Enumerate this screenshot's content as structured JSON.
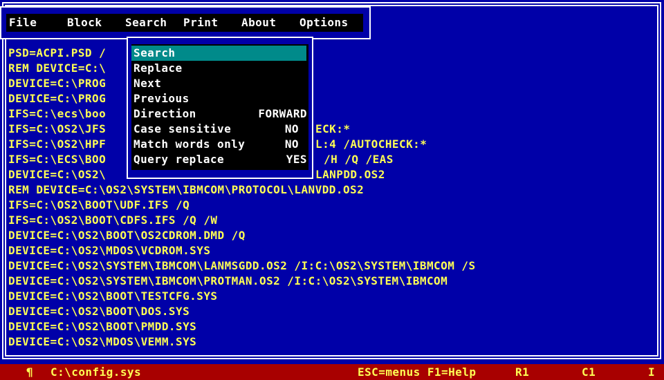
{
  "menu": {
    "items": [
      "File",
      "Block",
      "Search",
      "Print",
      "About",
      "Options"
    ]
  },
  "search_menu": {
    "items": [
      {
        "label": "Search",
        "value": ""
      },
      {
        "label": "Replace",
        "value": ""
      },
      {
        "label": "Next",
        "value": ""
      },
      {
        "label": "Previous",
        "value": ""
      },
      {
        "label": "Direction",
        "value": "FORWARD"
      },
      {
        "label": "Case sensitive",
        "value": "NO"
      },
      {
        "label": "Match words only",
        "value": "NO"
      },
      {
        "label": "Query replace",
        "value": "YES"
      }
    ],
    "selected_index": 0
  },
  "editor": {
    "lines": [
      "PSD=ACPI.PSD /",
      "REM DEVICE=C:\\",
      "DEVICE=C:\\PROG",
      "DEVICE=C:\\PROG",
      "IFS=C:\\ecs\\boo",
      "IFS=C:\\OS2\\JFS",
      "IFS=C:\\OS2\\HPF",
      "IFS=C:\\ECS\\BOO",
      "DEVICE=C:\\OS2\\",
      "REM DEVICE=C:\\OS2\\SYSTEM\\IBMCOM\\PROTOCOL\\LANVDD.OS2",
      "IFS=C:\\OS2\\BOOT\\UDF.IFS /Q",
      "IFS=C:\\OS2\\BOOT\\CDFS.IFS /Q /W",
      "DEVICE=C:\\OS2\\BOOT\\OS2CDROM.DMD /Q",
      "DEVICE=C:\\OS2\\MDOS\\VCDROM.SYS",
      "DEVICE=C:\\OS2\\SYSTEM\\IBMCOM\\LANMSGDD.OS2 /I:C:\\OS2\\SYSTEM\\IBMCOM /S",
      "DEVICE=C:\\OS2\\SYSTEM\\IBMCOM\\PROTMAN.OS2 /I:C:\\OS2\\SYSTEM\\IBMCOM",
      "DEVICE=C:\\OS2\\BOOT\\TESTCFG.SYS",
      "DEVICE=C:\\OS2\\BOOT\\DOS.SYS",
      "DEVICE=C:\\OS2\\BOOT\\PMDD.SYS",
      "DEVICE=C:\\OS2\\MDOS\\VEMM.SYS"
    ],
    "line_tails": [
      {
        "line": 5,
        "text": "ECK:*"
      },
      {
        "line": 6,
        "text": "L:4 /AUTOCHECK:*"
      },
      {
        "line": 7,
        "text": "/H /Q /EAS"
      },
      {
        "line": 8,
        "text": "LANPDD.OS2"
      }
    ]
  },
  "status": {
    "paragraph_icon": "¶",
    "filename": "C:\\config.sys",
    "hint": "ESC=menus F1=Help",
    "row": "R1",
    "col": "C1",
    "mode": "I"
  },
  "colors": {
    "background": "#0000A8",
    "text": "#FFFF54",
    "menu_bg": "#000000",
    "menu_text": "#FFFFFF",
    "highlight": "#008A8A",
    "statusbar": "#A80000"
  }
}
